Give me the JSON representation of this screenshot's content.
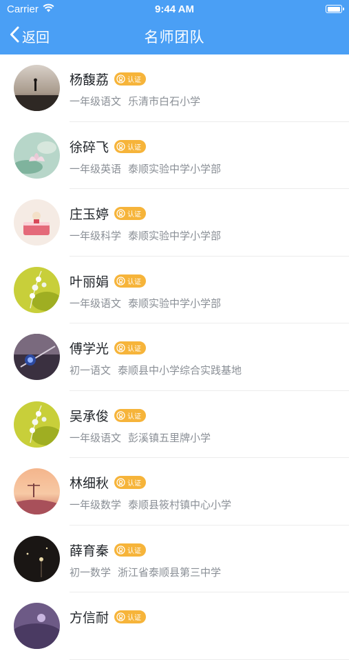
{
  "status_bar": {
    "carrier": "Carrier",
    "time": "9:44 AM",
    "battery_level": 1.0
  },
  "nav": {
    "back_label": "返回",
    "title": "名师团队"
  },
  "badge_label": "认证",
  "teachers": [
    {
      "name": "杨馥荔",
      "grade": "一年级语文",
      "school": "乐清市白石小学",
      "avatar": "sunset-figure"
    },
    {
      "name": "徐碎飞",
      "grade": "一年级英语",
      "school": "泰顺实验中学小学部",
      "avatar": "lotus-flower"
    },
    {
      "name": "庄玉婷",
      "grade": "一年级科学",
      "school": "泰顺实验中学小学部",
      "avatar": "cake-figurine"
    },
    {
      "name": "叶丽娟",
      "grade": "一年级语文",
      "school": "泰顺实验中学小学部",
      "avatar": "lily-of-valley"
    },
    {
      "name": "傅学光",
      "grade": "初一语文",
      "school": "泰顺县中小学综合实践基地",
      "avatar": "jewel-dark"
    },
    {
      "name": "吴承俊",
      "grade": "一年级语文",
      "school": "彭溪镇五里牌小学",
      "avatar": "lily-of-valley"
    },
    {
      "name": "林细秋",
      "grade": "一年级数学",
      "school": "泰顺县筱村镇中心小学",
      "avatar": "sunset-field"
    },
    {
      "name": "薛育秦",
      "grade": "初一数学",
      "school": "浙江省泰顺县第三中学",
      "avatar": "firefly-dark"
    },
    {
      "name": "方信耐",
      "grade": "",
      "school": "",
      "avatar": "purple-dusk"
    }
  ]
}
